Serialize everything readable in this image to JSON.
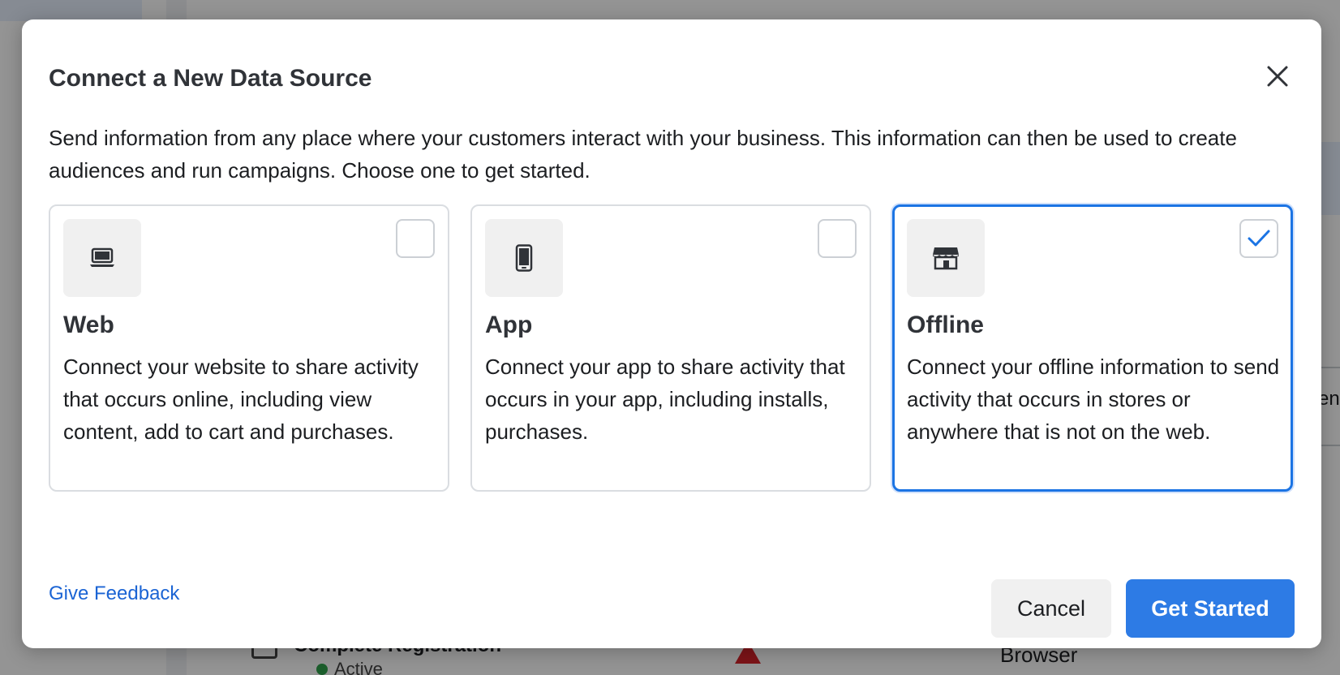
{
  "background": {
    "row_label": "Complete Registration",
    "row_status": "Active",
    "column_value": "Browser"
  },
  "modal": {
    "title": "Connect a New Data Source",
    "description": "Send information from any place where your customers interact with your business. This information can then be used to create audiences and run campaigns. Choose one to get started.",
    "options": [
      {
        "icon": "laptop-icon",
        "title": "Web",
        "description": "Connect your website to share activity that occurs online, including view content, add to cart and purchases.",
        "selected": false
      },
      {
        "icon": "mobile-phone-icon",
        "title": "App",
        "description": "Connect your app to share activity that occurs in your app, including installs, purchases.",
        "selected": false
      },
      {
        "icon": "store-icon",
        "title": "Offline",
        "description": "Connect your offline information to send activity that occurs in stores or anywhere that is not on the web.",
        "selected": true
      }
    ],
    "footer": {
      "feedback_label": "Give Feedback",
      "cancel_label": "Cancel",
      "start_label": "Get Started"
    }
  },
  "colors": {
    "accent": "#1b74e4",
    "primary_button": "#2d7be5",
    "link": "#1b64d4"
  }
}
